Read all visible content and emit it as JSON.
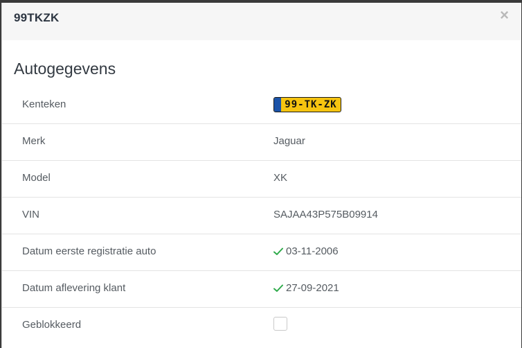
{
  "modal": {
    "title": "99TKZK",
    "close_label": "×"
  },
  "section": {
    "title": "Autogegevens"
  },
  "fields": [
    {
      "label": "Kenteken",
      "value": "99-TK-ZK"
    },
    {
      "label": "Merk",
      "value": "Jaguar"
    },
    {
      "label": "Model",
      "value": "XK"
    },
    {
      "label": "VIN",
      "value": "SAJAA43P575B09914"
    },
    {
      "label": "Datum eerste registratie auto",
      "value": "03-11-2006"
    },
    {
      "label": "Datum aflevering klant",
      "value": "27-09-2021"
    },
    {
      "label": "Geblokkeerd",
      "checked": false
    }
  ],
  "colors": {
    "plate_yellow": "#f6c410",
    "plate_blue": "#1b53a8",
    "check_green": "#2eaa4a"
  },
  "icons": {
    "close": "close-icon",
    "check": "check-icon"
  }
}
